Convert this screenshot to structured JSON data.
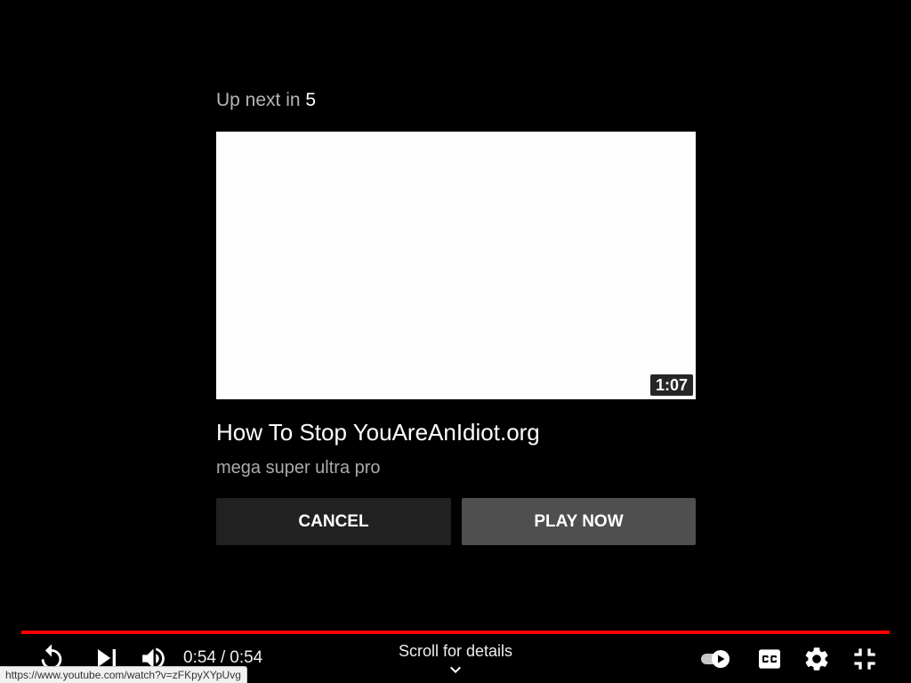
{
  "end_screen": {
    "up_next_label": "Up next in",
    "countdown": "5",
    "video": {
      "duration": "1:07",
      "title": "How To Stop YouAreAnIdiot.org",
      "channel": "mega super ultra pro"
    },
    "cancel_label": "CANCEL",
    "play_now_label": "PLAY NOW"
  },
  "controls": {
    "progress": 1.0,
    "time_current": "0:54",
    "time_separator": "/",
    "time_total": "0:54",
    "scroll_hint": "Scroll for details",
    "autoplay_on": true,
    "icons": {
      "replay": "replay-icon",
      "next": "next-icon",
      "volume": "volume-icon",
      "autoplay": "autoplay-toggle-icon",
      "captions": "closed-captions-icon",
      "settings": "settings-gear-icon",
      "fullscreen": "exit-fullscreen-icon",
      "scroll": "chevron-down-icon"
    }
  },
  "status_bar": {
    "url": "https://www.youtube.com/watch?v=zFKpyXYpUvg"
  },
  "colors": {
    "background": "#000000",
    "progress": "#ff0000",
    "text_primary": "#ffffff",
    "text_secondary": "#aaaaaa",
    "up_next_label": "#b5b5b5",
    "cancel_button": "#212121",
    "play_button": "#4f4f4f",
    "thumbnail": "#fdfdfd",
    "status_bar": "#f1f1f1"
  }
}
